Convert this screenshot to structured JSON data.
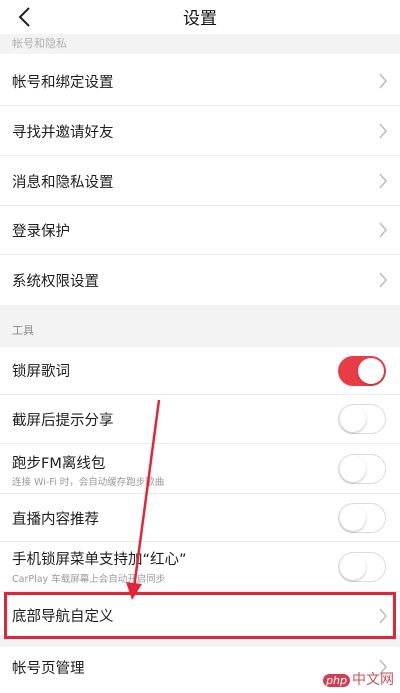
{
  "header": {
    "title": "设置"
  },
  "sections": [
    {
      "label": "帐号和隐私"
    },
    {
      "label": "工具"
    }
  ],
  "rows": [
    {
      "label": "帐号和绑定设置"
    },
    {
      "label": "寻找并邀请好友"
    },
    {
      "label": "消息和隐私设置"
    },
    {
      "label": "登录保护"
    },
    {
      "label": "系统权限设置"
    },
    {
      "label": "锁屏歌词",
      "toggle": "on"
    },
    {
      "label": "截屏后提示分享",
      "toggle": "off"
    },
    {
      "label": "跑步FM离线包",
      "sub": "连接 Wi-Fi 时，会自动缓存跑步歌曲",
      "toggle": "off"
    },
    {
      "label": "直播内容推荐",
      "toggle": "off"
    },
    {
      "label": "手机锁屏菜单支持加“红心”",
      "sub": "CarPlay 车载屏幕上会自动开启同步",
      "toggle": "off"
    },
    {
      "label": "底部导航自定义"
    },
    {
      "label": "帐号页管理"
    }
  ],
  "watermark": {
    "logo": "php",
    "text": "中文网"
  },
  "colors": {
    "accent": "#e93d45",
    "annotation": "#e3253a"
  }
}
